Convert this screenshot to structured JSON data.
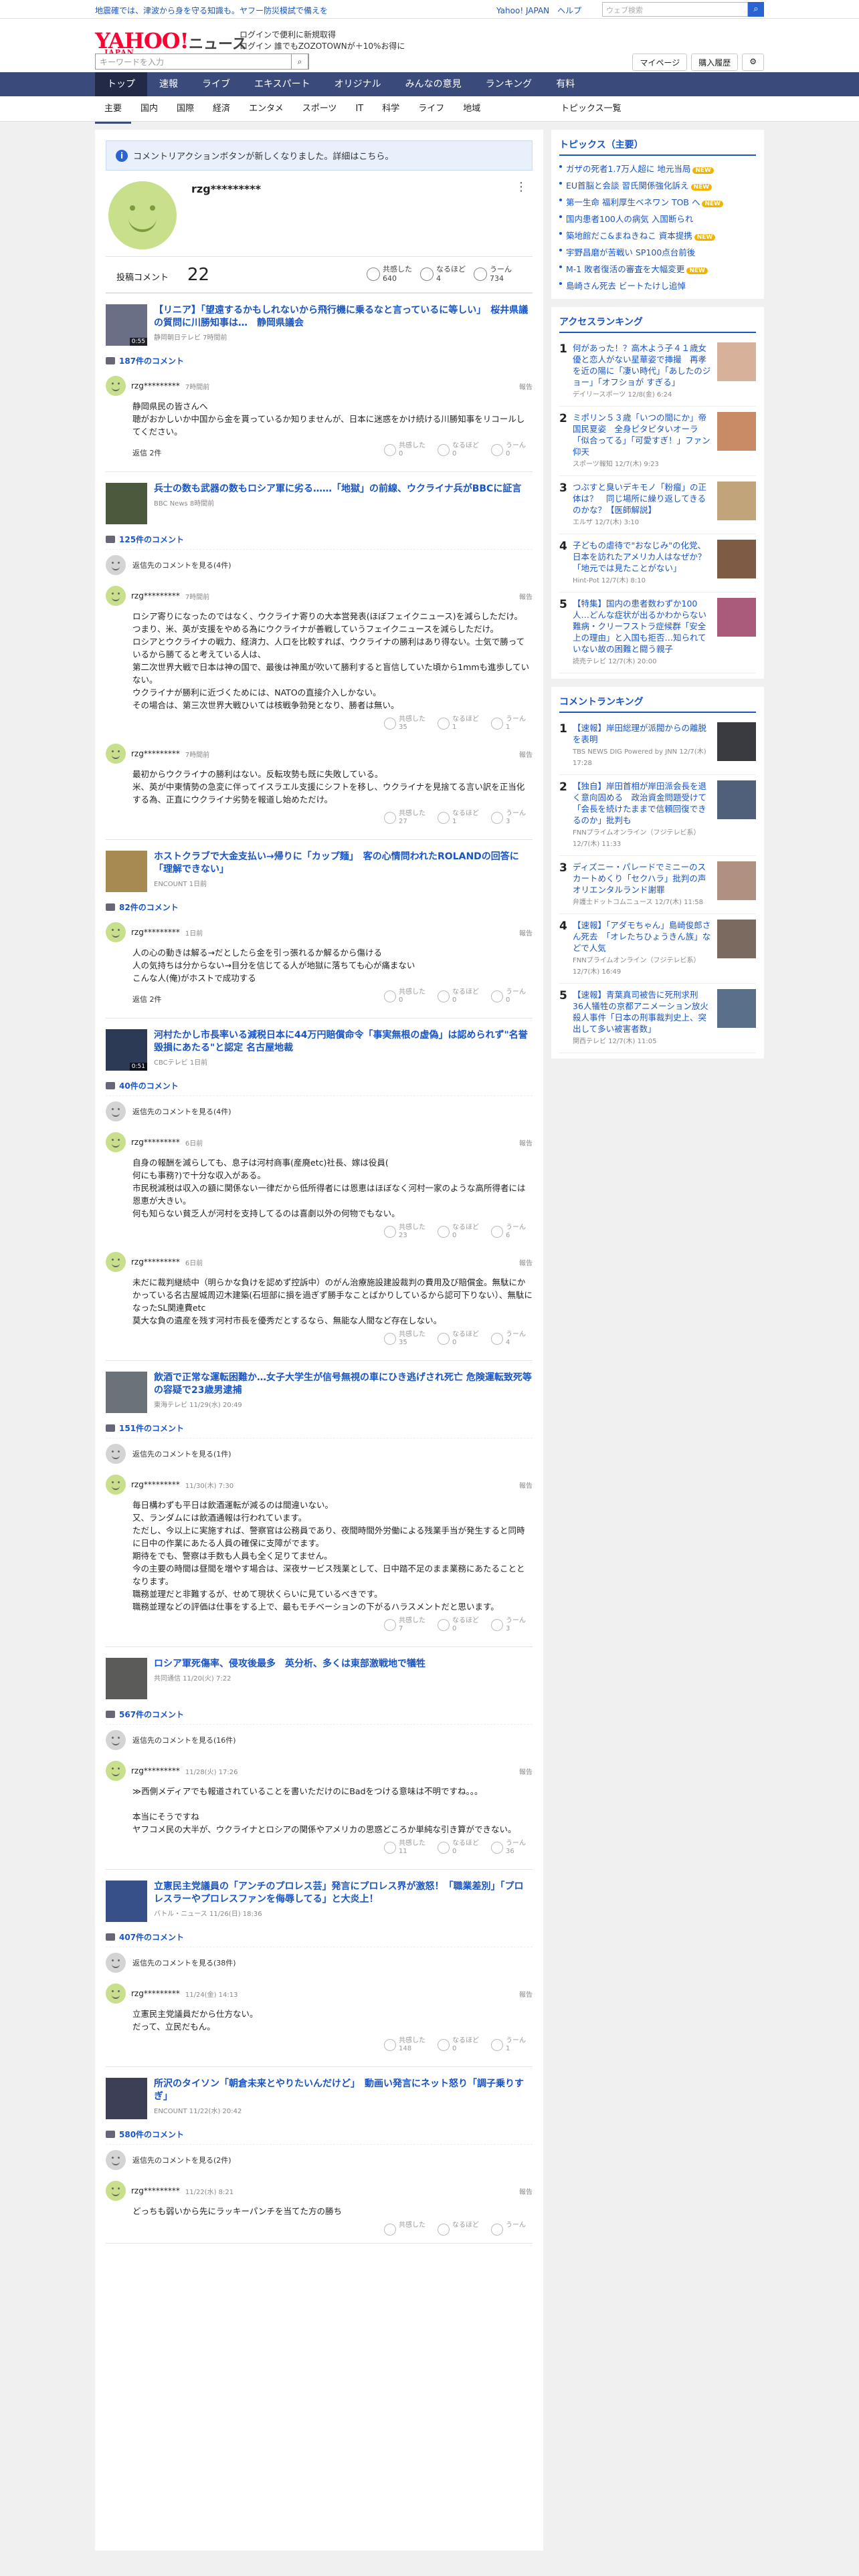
{
  "topbar": {
    "notice": "地震確では、津波から身を守る知識も。ヤフー防災模試で備えを",
    "links": [
      "Yahoo! JAPAN",
      "ヘルプ"
    ],
    "search_placeholder": "ウェブ検索"
  },
  "header": {
    "logo": "YAHOO!",
    "logo_sub": "JAPAN",
    "news": "ニュース",
    "promo1": "ログインで便利に新規取得",
    "promo2": "ログイン 誰でもZOZOTOWNが＋10%お得に",
    "search_placeholder": "キーワードを入力",
    "mypage": "マイページ",
    "purchase": "購入履歴"
  },
  "gnav": [
    "トップ",
    "速報",
    "ライブ",
    "エキスパート",
    "オリジナル",
    "みんなの意見",
    "ランキング",
    "有料"
  ],
  "subnav": [
    "主要",
    "国内",
    "国際",
    "経済",
    "エンタメ",
    "スポーツ",
    "IT",
    "科学",
    "ライフ",
    "地域"
  ],
  "subnav_right": "トピックス一覧",
  "info": "コメントリアクションボタンが新しくなりました。詳細はこちら。",
  "profile": {
    "name": "rzg*********"
  },
  "stats": {
    "label": "投稿コメント",
    "count": "22",
    "s1_label": "共感した",
    "s1": "640",
    "s2_label": "なるほど",
    "s2": "4",
    "s3_label": "うーん",
    "s3": "734"
  },
  "reply_label": "返信先のコメントを見る",
  "blocks": [
    {
      "title": "【リニア】「望遠するかもしれないから飛行機に乗るなと言っているに等しい」　桜井県議の質問に川勝知事は…　静岡県議会",
      "source": "静岡朝日テレビ 7時間前",
      "count": "187件のコメント",
      "thumb": "#6a6f86",
      "dur": "0:55",
      "replies": [],
      "comments": [
        {
          "user": "rzg*********",
          "date": "7時間前",
          "body": "静岡県民の皆さんへ\n聴がおかしいか中国から金を貰っているか知りませんが、日本に迷惑をかけ続ける川勝知事をリコールしてください。",
          "r": [
            "0",
            "0",
            "0"
          ],
          "reply": "返信 2件"
        }
      ]
    },
    {
      "title": "兵士の数も武器の数もロシア軍に劣る……「地獄」の前線、ウクライナ兵がBBCに証言",
      "source": "BBC News 8時間前",
      "count": "125件のコメント",
      "thumb": "#4b5a3c",
      "dur": "",
      "replies": [
        "返信先のコメントを見る(4件)"
      ],
      "comments": [
        {
          "user": "rzg*********",
          "date": "7時間前",
          "body": "ロシア寄りになったのではなく、ウクライナ寄りの大本営発表(ほぼフェイクニュース)を減らしただけ。\nつまり、米、英が支援をやめる為にウクライナが善戦していうフェイクニュースを減らしただけ。\nロシアとウクライナの戦力、経済力、人口を比較すれば、ウクライナの勝利はあり得ない。士気で勝っているから勝てると考えている人は、\n第二次世界大戦で日本は神の国で、最後は神風が吹いて勝利すると盲信していた頃から1mmも進歩していない。\nウクライナが勝利に近づくためには、NATOの直接介入しかない。\nその場合は、第三次世界大戦ひいては核戦争勃発となり、勝者は無い。",
          "r": [
            "35",
            "1",
            "1"
          ],
          "reply": ""
        },
        {
          "user": "rzg*********",
          "date": "7時間前",
          "body": "最初からウクライナの勝利はない。反転攻勢も既に失敗している。\n米、英が中東情勢の急変に伴ってイスラエル支援にシフトを移し、ウクライナを見捨てる言い訳を正当化する為、正直にウクライナ劣勢を報道し始めただけ。",
          "r": [
            "27",
            "1",
            "3"
          ],
          "reply": ""
        }
      ]
    },
    {
      "title": "ホストクラブで大金支払い→帰りに「カップ麺」　客の心情問われたROLANDの回答に「理解できない」",
      "source": "ENCOUNT 1日前",
      "count": "82件のコメント",
      "thumb": "#a68a52",
      "dur": "",
      "replies": [],
      "comments": [
        {
          "user": "rzg*********",
          "date": "1日前",
          "body": "人の心の動きは解る→だとしたら金を引っ張れるか解るから傷ける\n人の気持ちは分からない→目分を信じてる人が地獄に落ちても心が痛まない\nこんな人(俺)がホストで成功する",
          "r": [
            "0",
            "0",
            "0"
          ],
          "reply": "返信 2件"
        }
      ]
    },
    {
      "title": "河村たかし市長率いる減税日本に44万円賠償命令「事実無根の虚偽」は認められず\"名誉毀損にあたる\"と認定 名古屋地裁",
      "source": "CBCテレビ 1日前",
      "count": "40件のコメント",
      "thumb": "#2d3a55",
      "dur": "0:51",
      "replies": [
        "返信先のコメントを見る(4件)"
      ],
      "comments": [
        {
          "user": "rzg*********",
          "date": "6日前",
          "body": "自身の報酬を減らしても、息子は河村商事(産廃etc)社長、嫁は役員(\n何にも事務?)で十分な収入がある。\n市民税減税は収入の額に関係ない一律だから低所得者には恩恵はほぼなく河村一家のような高所得者には恩恵が大きい。\n何も知らない貧乏人が河村を支持してるのは喜劇以外の何物でもない。",
          "r": [
            "23",
            "0",
            "6"
          ],
          "reply": ""
        },
        {
          "user": "rzg*********",
          "date": "6日前",
          "body": "未だに裁判継続中（明らかな負けを認めず控訴中）のがん治療施設建設裁判の費用及び賠償金。無駄にかかっている名古屋城周辺木建築(石垣部に損を過ぎず勝手なことばかりしているから認可下りない）、無駄になったSL関連費etc\n莫大な負の遺産を残す河村市長を優秀だとするなら、無能な人間など存在しない。",
          "r": [
            "35",
            "0",
            "4"
          ],
          "reply": ""
        }
      ]
    },
    {
      "title": "飲酒で正常な運転困難か…女子大学生が信号無視の車にひき逃げされ死亡 危険運転致死等の容疑で23歳男逮捕",
      "source": "東海テレビ 11/29(水) 20:49",
      "count": "151件のコメント",
      "thumb": "#6c7378",
      "dur": "",
      "replies": [
        "返信先のコメントを見る(1件)"
      ],
      "comments": [
        {
          "user": "rzg*********",
          "date": "11/30(木) 7:30",
          "body": "毎日構わずも平日は飲酒運転が減るのは間違いない。\n又、ランダムには飲酒通報は行われています。\nただし、今以上に実施すれば、警察官は公務員であり、夜間時間外労働による残業手当が発生すると同時に日中の作業にあたる人員の確保に支障がでます。\n期待をでも、警察は手数も人員も全く足りてません。\n今の主要の時間は昼間を増やす場合は、深夜サービス残業として、日中踏不足のまま業務にあたることとなります。\n職務並理だと非難するが、せめて現状くらいに見ているべきです。\n職務並理などの評価は仕事をする上で、最もモチベーションの下がるハラスメントだと思います。",
          "r": [
            "7",
            "0",
            "3"
          ],
          "reply": ""
        }
      ]
    },
    {
      "title": "ロシア軍死傷率、侵攻後最多　英分析、多くは東部激戦地で犠牲",
      "source": "共同通信 11/20(火) 7:22",
      "count": "567件のコメント",
      "thumb": "#5b5c59",
      "dur": "",
      "replies": [
        "返信先のコメントを見る(16件)"
      ],
      "comments": [
        {
          "user": "rzg*********",
          "date": "11/28(火) 17:26",
          "body": "≫西側メディアでも報道されていることを書いただけのにBadをつける意味は不明ですね。。。\n\n本当にそうですね\nヤフコメ民の大半が、ウクライナとロシアの関係やアメリカの思惑どころか単純な引き算ができない。",
          "r": [
            "11",
            "0",
            "36"
          ],
          "reply": ""
        }
      ]
    },
    {
      "title": "立憲民主党議員の「アンチのプロレス芸」発言にプロレス界が激怒！「職業差別」「プロレスラーやプロレスファンを侮辱してる」と大炎上！",
      "source": "バトル・ニュース 11/26(日) 18:36",
      "count": "407件のコメント",
      "thumb": "#38508a",
      "dur": "",
      "replies": [
        "返信先のコメントを見る(38件)"
      ],
      "comments": [
        {
          "user": "rzg*********",
          "date": "11/24(金) 14:13",
          "body": "立憲民主党議員だから仕方ない。\nだって、立民だもん。",
          "r": [
            "148",
            "0",
            "1"
          ],
          "reply": ""
        }
      ]
    },
    {
      "title": "所沢のタイソン「朝倉未来とやりたいんだけど」　動画い発言にネット怒り「調子乗りすぎ」",
      "source": "ENCOUNT 11/22(水) 20:42",
      "count": "580件のコメント",
      "thumb": "#3d3f57",
      "dur": "",
      "replies": [
        "返信先のコメントを見る(2件)"
      ],
      "comments": [
        {
          "user": "rzg*********",
          "date": "11/22(水) 8:21",
          "body": "どっちも弱いから先にラッキーパンチを当てた方の勝ち",
          "r": [
            "",
            "",
            ""
          ],
          "reply": ""
        }
      ]
    }
  ],
  "sidebar": {
    "topics_title": "トピックス（主要）",
    "topics": [
      {
        "t": "ガザの死者1.7万人超に 地元当局",
        "new": true
      },
      {
        "t": "EU首脳と会談 習氏関係強化訴え",
        "new": true
      },
      {
        "t": "第一生命 福利厚生ベネワン TOB へ",
        "new": true
      },
      {
        "t": "国内患者100人の病気 入国断られ",
        "new": false
      },
      {
        "t": "築地館だこ&まねきねこ 資本提携",
        "new": true
      },
      {
        "t": "宇野昌磨が苦戦い SP100点台前後",
        "new": false
      },
      {
        "t": "M-1 敗者復活の審査を大幅変更",
        "new": true
      },
      {
        "t": "島崎さん死去 ビートたけし追悼",
        "new": false
      }
    ],
    "access_title": "アクセスランキング",
    "access": [
      {
        "t": "何があった！？高木よう子４１歳女優と恋人がない星華姿で挿撮　再孝を近の陽に「凄い時代」「あしたのジョー」「オフショが すぎる」",
        "s": "デイリースポーツ 12/8(金) 6:24",
        "c": "#d8b19a"
      },
      {
        "t": "ミポリン５３歳「いつの間にか」帝国民夏姿　全身ピタピタいオーラ「似合ってる」「可愛すぎ！」ファン仰天",
        "s": "スポーツ報知 12/7(木) 9:23",
        "c": "#c98b65"
      },
      {
        "t": "つぶすと臭いデキモノ「粉瘤」の正体は？　同じ場所に繰り返してきるのかな？【医師解説】",
        "s": "エルザ 12/7(木) 3:10",
        "c": "#c2a47a"
      },
      {
        "t": "子どもの虐待で\"おなじみ\"の化党、日本を訪れたアメリカ人はなぜか？「地元では見たことがない」",
        "s": "Hint-Pot 12/7(木) 8:10",
        "c": "#7e5b44"
      },
      {
        "t": "【特集】国内の患者数わずか100人…どんな症状が出るかわからない難病・クリーフストラ症候群「安全上の理由」と入国も拒否…知られていない故の困難と闘う親子",
        "s": "読売テレビ 12/7(木) 20:00",
        "c": "#aa5a7a"
      }
    ],
    "comment_title": "コメントランキング",
    "comment": [
      {
        "t": "【速報】岸田総理が派閥からの離脱を表明",
        "s": "TBS NEWS DIG Powered by JNN 12/7(木) 17:28",
        "c": "#3a3b40"
      },
      {
        "t": "【独自】岸田首相が岸田派会長を退く意向固める　政治資金問題受けて「会長を続けたままで信頼回復できるのか」批判も",
        "s": "FNNプライムオンライン（フジテレビ系）12/7(木) 11:33",
        "c": "#50607a"
      },
      {
        "t": "ディズニー・パレードでミニーのスカートめくり「セクハラ」批判の声　オリエンタルランド謝罪",
        "s": "弁護士ドットコムニュース 12/7(木) 11:58",
        "c": "#b09080"
      },
      {
        "t": "【速報】「アダモちゃん」島崎俊郎さん死去　「オレたちひょうきん族」などで人気",
        "s": "FNNプライムオンライン（フジテレビ系）12/7(木) 16:49",
        "c": "#7a6a60"
      },
      {
        "t": "【速報】青葉真司被告に死刑求刑　36人犠牲の京都アニメーション放火殺人事件「日本の刑事裁判史上、突出して多い被害者数」",
        "s": "関西テレビ 12/7(木) 11:05",
        "c": "#5a6f8a"
      }
    ]
  }
}
